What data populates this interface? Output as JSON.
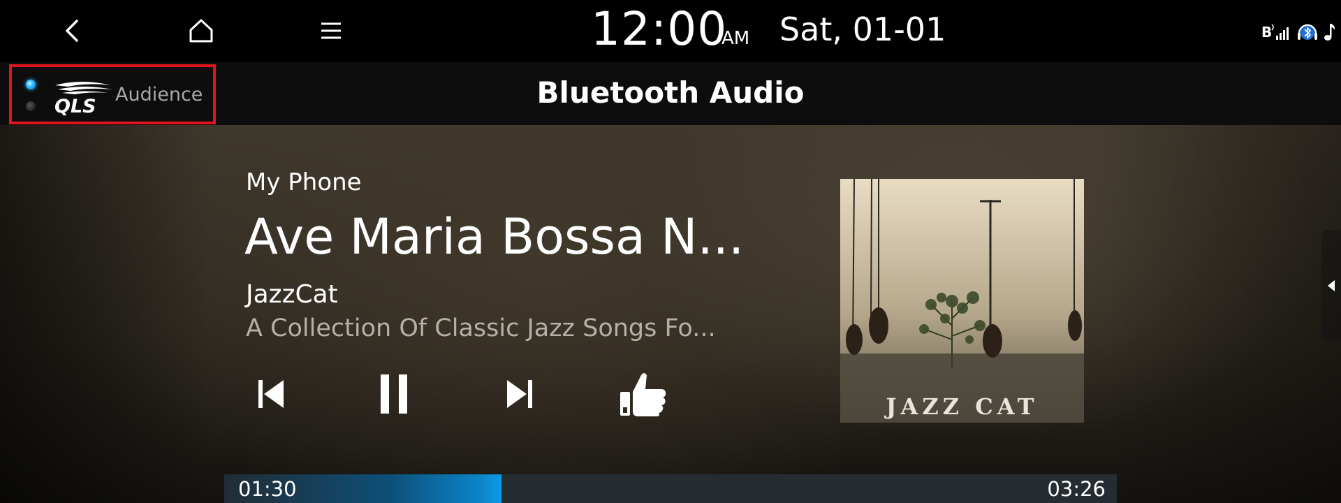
{
  "status_bar": {
    "time": "12:00",
    "ampm": "AM",
    "date": "Sat, 01-01",
    "icons": [
      "back-icon",
      "home-icon",
      "menu-icon",
      "bluetooth-signal-icon",
      "bluetooth-headset-icon",
      "music-note-icon"
    ]
  },
  "title_bar": {
    "title": "Bluetooth Audio",
    "sound_mode": {
      "logo": "QLS",
      "label": "Audience",
      "indicators": [
        "on",
        "off"
      ]
    }
  },
  "player": {
    "source": "My Phone",
    "song_title": "Ave Maria Bossa N...",
    "artist": "JazzCat",
    "album": "A Collection Of Classic Jazz Songs Fo...",
    "album_art_text": "JAZZ CAT",
    "controls": {
      "previous": "previous-track-icon",
      "pause": "pause-icon",
      "next": "next-track-icon",
      "like": "thumbs-up-icon"
    },
    "progress": {
      "elapsed": "01:30",
      "total": "03:26",
      "fraction": 0.311
    }
  },
  "colors": {
    "highlight_border": "#e0141d",
    "progress_accent": "#0a9be8",
    "indicator_on": "#28b7ff"
  }
}
